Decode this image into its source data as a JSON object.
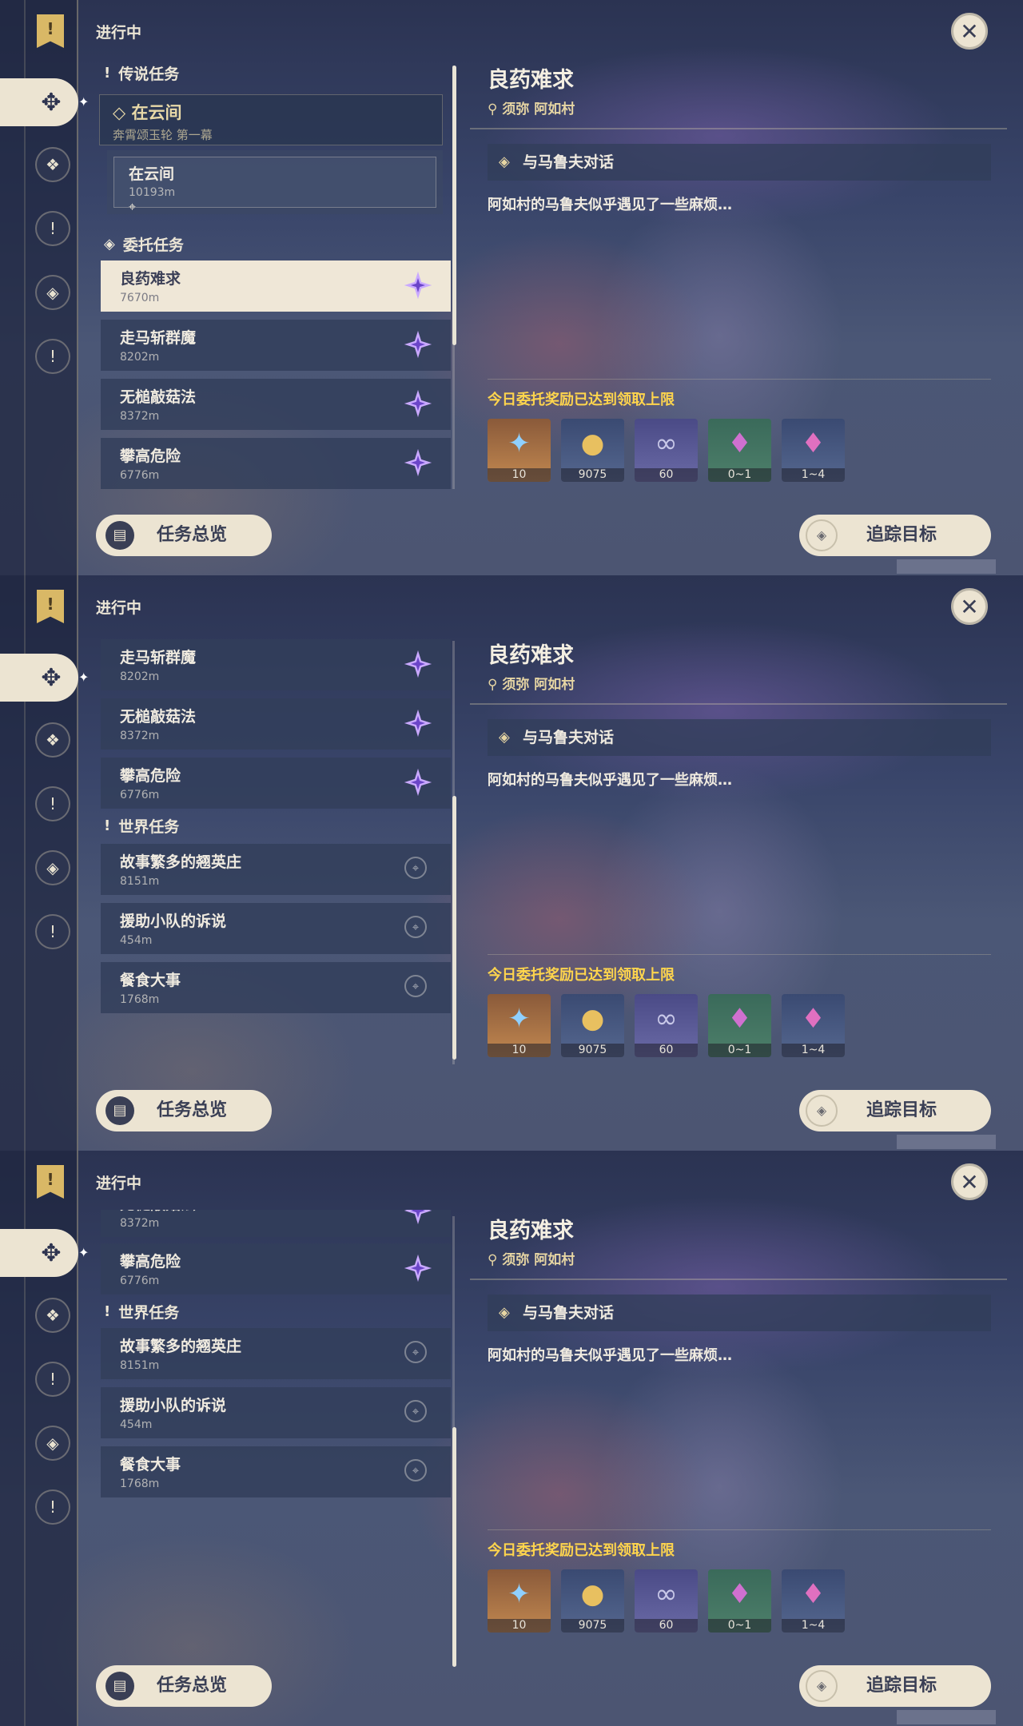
{
  "status": "进行中",
  "close_icon": "✕",
  "rail_banner_icon": "!",
  "sections": {
    "legend": "传说任务",
    "commission": "委托任务",
    "world": "世界任务"
  },
  "legend_group": {
    "title": "在云间",
    "subtitle": "奔霄颂玉轮 第一幕"
  },
  "legend_sub": {
    "title": "在云间",
    "distance": "10193m"
  },
  "quests": {
    "q1": {
      "title": "良药难求",
      "distance": "7670m"
    },
    "q2": {
      "title": "走马斩群魔",
      "distance": "8202m"
    },
    "q3": {
      "title": "无槌敲菇法",
      "distance": "8372m"
    },
    "q4": {
      "title": "攀高危险",
      "distance": "6776m"
    },
    "w1": {
      "title": "故事繁多的翘英庄",
      "distance": "8151m"
    },
    "w2": {
      "title": "援助小队的诉说",
      "distance": "454m"
    },
    "w3": {
      "title": "餐食大事",
      "distance": "1768m"
    }
  },
  "detail": {
    "title": "良药难求",
    "location": "须弥 阿如村",
    "objective": "与马鲁夫对话",
    "description": "阿如村的马鲁夫似乎遇见了一些麻烦…",
    "reward_note": "今日委托奖励已达到领取上限",
    "rewards": [
      "10",
      "9075",
      "60",
      "0~1",
      "1~4"
    ]
  },
  "buttons": {
    "overview": "任务总览",
    "track": "追踪目标"
  },
  "colors": {
    "reward_note": "#ffd54d",
    "selected_bg": "#efe7d7",
    "commission_star": "#b79cff"
  }
}
